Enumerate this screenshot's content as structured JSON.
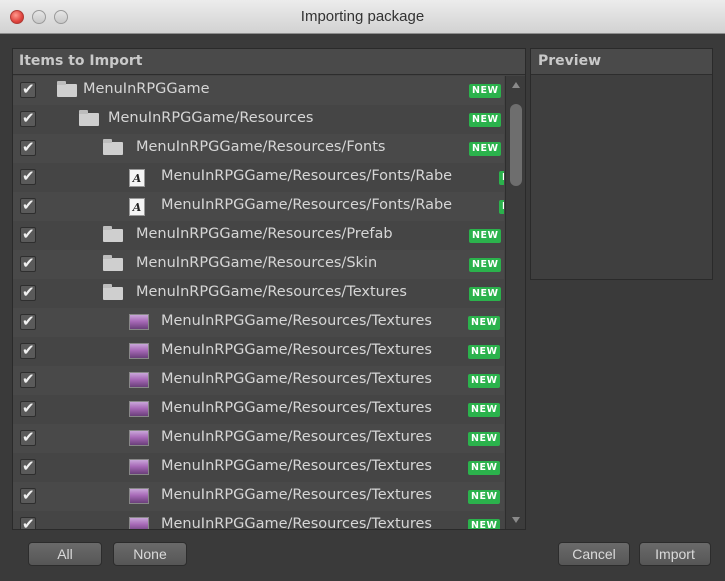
{
  "window": {
    "title": "Importing package"
  },
  "items_panel": {
    "title": "Items to Import"
  },
  "preview_panel": {
    "title": "Preview"
  },
  "badge_label": "NEW",
  "items": [
    {
      "label": "MenuInRPGGame",
      "type": "folder",
      "indent": 0,
      "checked": true,
      "new": true
    },
    {
      "label": "MenuInRPGGame/Resources",
      "type": "folder",
      "indent": 1,
      "checked": true,
      "new": true
    },
    {
      "label": "MenuInRPGGame/Resources/Fonts",
      "type": "folder",
      "indent": 2,
      "checked": true,
      "new": true
    },
    {
      "label": "MenuInRPGGame/Resources/Fonts/Rabe",
      "type": "font",
      "indent": 3,
      "checked": true,
      "new": true
    },
    {
      "label": "MenuInRPGGame/Resources/Fonts/Rabe",
      "type": "font",
      "indent": 3,
      "checked": true,
      "new": true
    },
    {
      "label": "MenuInRPGGame/Resources/Prefab",
      "type": "folder",
      "indent": 2,
      "checked": true,
      "new": true
    },
    {
      "label": "MenuInRPGGame/Resources/Skin",
      "type": "folder",
      "indent": 2,
      "checked": true,
      "new": true
    },
    {
      "label": "MenuInRPGGame/Resources/Textures",
      "type": "folder",
      "indent": 2,
      "checked": true,
      "new": true
    },
    {
      "label": "MenuInRPGGame/Resources/Textures",
      "type": "texture",
      "indent": 3,
      "checked": true,
      "new": true
    },
    {
      "label": "MenuInRPGGame/Resources/Textures",
      "type": "texture",
      "indent": 3,
      "checked": true,
      "new": true
    },
    {
      "label": "MenuInRPGGame/Resources/Textures",
      "type": "texture",
      "indent": 3,
      "checked": true,
      "new": true
    },
    {
      "label": "MenuInRPGGame/Resources/Textures",
      "type": "texture",
      "indent": 3,
      "checked": true,
      "new": true
    },
    {
      "label": "MenuInRPGGame/Resources/Textures",
      "type": "texture",
      "indent": 3,
      "checked": true,
      "new": true
    },
    {
      "label": "MenuInRPGGame/Resources/Textures",
      "type": "texture",
      "indent": 3,
      "checked": true,
      "new": true
    },
    {
      "label": "MenuInRPGGame/Resources/Textures",
      "type": "texture",
      "indent": 3,
      "checked": true,
      "new": true
    },
    {
      "label": "MenuInRPGGame/Resources/Textures",
      "type": "texture",
      "indent": 3,
      "checked": true,
      "new": true
    }
  ],
  "buttons": {
    "all": "All",
    "none": "None",
    "cancel": "Cancel",
    "import": "Import"
  },
  "colors": {
    "new_badge": "#2bb24c",
    "panel_bg": "#474747"
  }
}
